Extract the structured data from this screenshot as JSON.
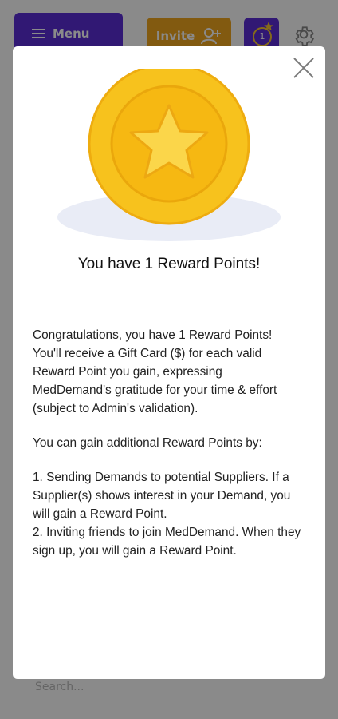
{
  "app": {
    "menu_label": "Menu",
    "invite_label": "Invite",
    "reward_count": "1",
    "search_placeholder": "Search..."
  },
  "modal": {
    "title": "You have 1 Reward Points!",
    "paragraph1": "Congratulations, you have 1 Reward Points! You'll receive a Gift Card ($) for each valid Reward Point you gain, expressing MedDemand's gratitude for your time & effort (subject to Admin's validation).",
    "paragraph2": "You can gain additional Reward Points by:",
    "item1": "1. Sending Demands to potential Suppliers. If a Supplier(s) shows interest in your Demand, you will gain a Reward Point.",
    "item2": "2. Inviting friends to join MedDemand. When they sign up, you will gain a Reward Point.",
    "colors": {
      "primary": "#5b2ed6",
      "accent": "#f0a71f",
      "coin": "#f7c21d"
    }
  }
}
